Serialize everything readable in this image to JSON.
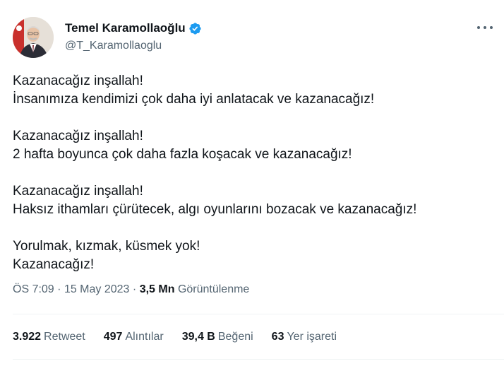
{
  "author": {
    "name": "Temel Karamollaoğlu",
    "handle": "@T_Karamollaoglu",
    "verified_icon": "verified-badge-icon",
    "accent_color": "#1d9bf0"
  },
  "tweet": {
    "paragraphs": [
      [
        "Kazanacağız inşallah!",
        "İnsanımıza kendimizi çok daha iyi anlatacak ve kazanacağız!"
      ],
      [
        "Kazanacağız inşallah!",
        "2 hafta boyunca çok daha fazla koşacak ve kazanacağız!"
      ],
      [
        "Kazanacağız inşallah!",
        "Haksız ithamları çürütecek, algı oyunlarını bozacak ve kazanacağız!"
      ],
      [
        "Yorulmak, kızmak, küsmek yok!",
        "Kazanacağız!"
      ]
    ]
  },
  "meta": {
    "time": "ÖS 7:09",
    "separator": "·",
    "date": "15 May 2023",
    "views_count": "3,5 Mn",
    "views_label": "Görüntülenme"
  },
  "stats": [
    {
      "count": "3.922",
      "label": "Retweet"
    },
    {
      "count": "497",
      "label": "Alıntılar"
    },
    {
      "count": "39,4 B",
      "label": "Beğeni"
    },
    {
      "count": "63",
      "label": "Yer işareti"
    }
  ]
}
